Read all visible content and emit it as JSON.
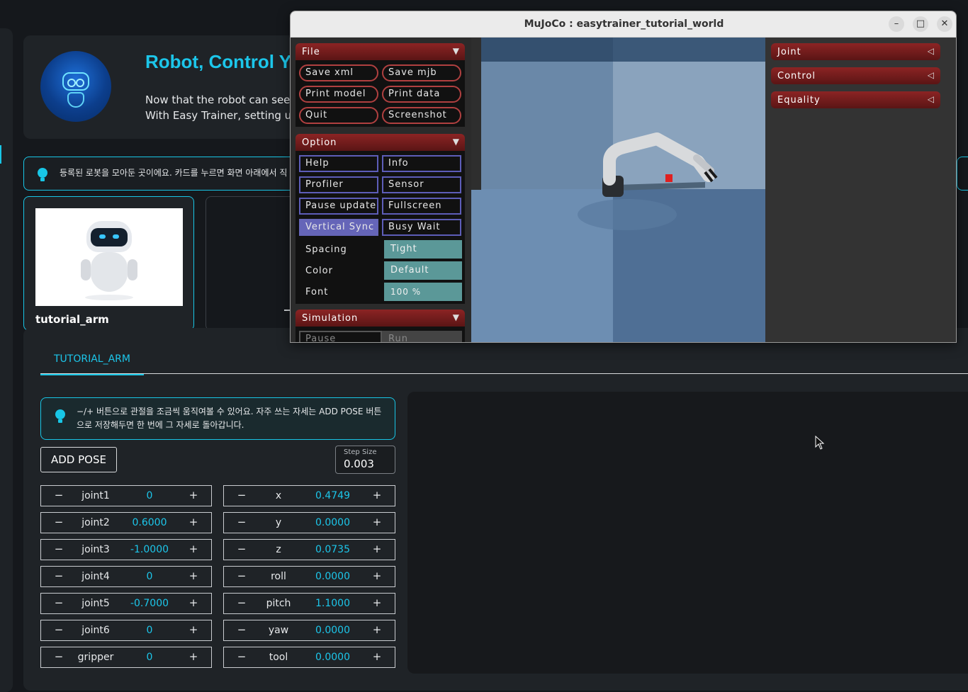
{
  "hero": {
    "title": "Robot, Control Yo",
    "line1": "Now that the robot can see a",
    "line2": "With Easy Trainer, setting up"
  },
  "banner_top": {
    "text": "등록된 로봇을 모아둔 곳이에요. 카드를 누르면 화면 아래에서 직"
  },
  "robot_card": {
    "name": "tutorial_arm"
  },
  "tab": {
    "label": "TUTORIAL_ARM"
  },
  "banner2": {
    "text": "−/+ 버튼으로 관절을 조금씩 움직여볼 수 있어요. 자주 쓰는 자세는 ADD POSE 버튼으로 저장해두면 한 번에 그 자세로 돌아갑니다."
  },
  "add_pose": {
    "label": "ADD POSE"
  },
  "step_size": {
    "label": "Step Size",
    "value": "0.003"
  },
  "minus_symbol": "−",
  "plus_symbol": "+",
  "joints": [
    {
      "name": "joint1",
      "value": "0"
    },
    {
      "name": "joint2",
      "value": "0.6000"
    },
    {
      "name": "joint3",
      "value": "-1.0000"
    },
    {
      "name": "joint4",
      "value": "0"
    },
    {
      "name": "joint5",
      "value": "-0.7000"
    },
    {
      "name": "joint6",
      "value": "0"
    },
    {
      "name": "gripper",
      "value": "0"
    }
  ],
  "cartesian": [
    {
      "name": "x",
      "value": "0.4749"
    },
    {
      "name": "y",
      "value": "0.0000"
    },
    {
      "name": "z",
      "value": "0.0735"
    },
    {
      "name": "roll",
      "value": "0.0000"
    },
    {
      "name": "pitch",
      "value": "1.1000"
    },
    {
      "name": "yaw",
      "value": "0.0000"
    },
    {
      "name": "tool",
      "value": "0.0000"
    }
  ],
  "mujoco": {
    "title": "MuJoCo : easytrainer_tutorial_world",
    "window_buttons": {
      "minimize": "–",
      "maximize": "□",
      "close": "✕"
    },
    "file": {
      "header": "File",
      "buttons": [
        "Save xml",
        "Save mjb",
        "Print model",
        "Print data",
        "Quit",
        "Screenshot"
      ]
    },
    "option": {
      "header": "Option",
      "checks": [
        "Help",
        "Info",
        "Profiler",
        "Sensor",
        "Pause update",
        "Fullscreen",
        "Vertical Sync",
        "Busy Wait"
      ],
      "selects": [
        {
          "label": "Spacing",
          "value": "Tight"
        },
        {
          "label": "Color",
          "value": "Default"
        },
        {
          "label": "Font",
          "value": "100 %"
        }
      ]
    },
    "simulation": {
      "header": "Simulation",
      "radio": [
        "Pause",
        "Run"
      ]
    },
    "right_sections": [
      "Joint",
      "Control",
      "Equality"
    ],
    "collapse_glyph": "▼",
    "expand_glyph": "◁"
  },
  "colors": {
    "accent": "#18c6e6",
    "mujoco_section": "#8c2424",
    "mujoco_select": "#5b9898",
    "mujoco_check_on": "#6565b8"
  }
}
